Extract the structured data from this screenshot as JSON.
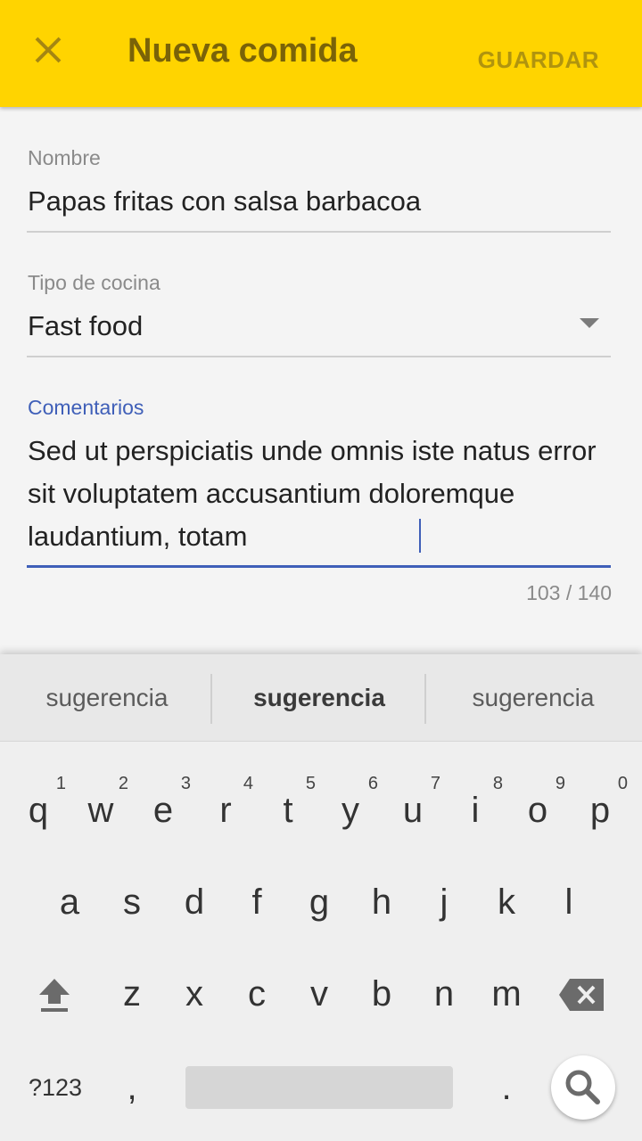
{
  "app_bar": {
    "title": "Nueva comida",
    "save_label": "GUARDAR",
    "close_icon": "close-icon",
    "colors": {
      "background": "#ffd400",
      "title": "#7a6308",
      "save": "#b0940e"
    }
  },
  "form": {
    "name": {
      "label": "Nombre",
      "value": "Papas fritas con salsa barbacoa"
    },
    "cuisine": {
      "label": "Tipo de cocina",
      "value": "Fast food",
      "icon": "dropdown-arrow-icon"
    },
    "comments": {
      "label": "Comentarios",
      "value": "Sed ut perspiciatis unde omnis iste natus error sit voluptatem accusantium doloremque laudantium, totam",
      "counter": "103 / 140",
      "accent": "#3f5fb8"
    }
  },
  "keyboard": {
    "suggestions": [
      "sugerencia",
      "sugerencia",
      "sugerencia"
    ],
    "row1": [
      {
        "key": "q",
        "num": "1"
      },
      {
        "key": "w",
        "num": "2"
      },
      {
        "key": "e",
        "num": "3"
      },
      {
        "key": "r",
        "num": "4"
      },
      {
        "key": "t",
        "num": "5"
      },
      {
        "key": "y",
        "num": "6"
      },
      {
        "key": "u",
        "num": "7"
      },
      {
        "key": "i",
        "num": "8"
      },
      {
        "key": "o",
        "num": "9"
      },
      {
        "key": "p",
        "num": "0"
      }
    ],
    "row2": [
      "a",
      "s",
      "d",
      "f",
      "g",
      "h",
      "j",
      "k",
      "l"
    ],
    "row3": [
      "z",
      "x",
      "c",
      "v",
      "b",
      "n",
      "m"
    ],
    "bottom": {
      "symbols": "?123",
      "comma": ",",
      "period": "."
    },
    "icons": {
      "shift": "shift-icon",
      "backspace": "backspace-icon",
      "search": "search-icon"
    }
  }
}
